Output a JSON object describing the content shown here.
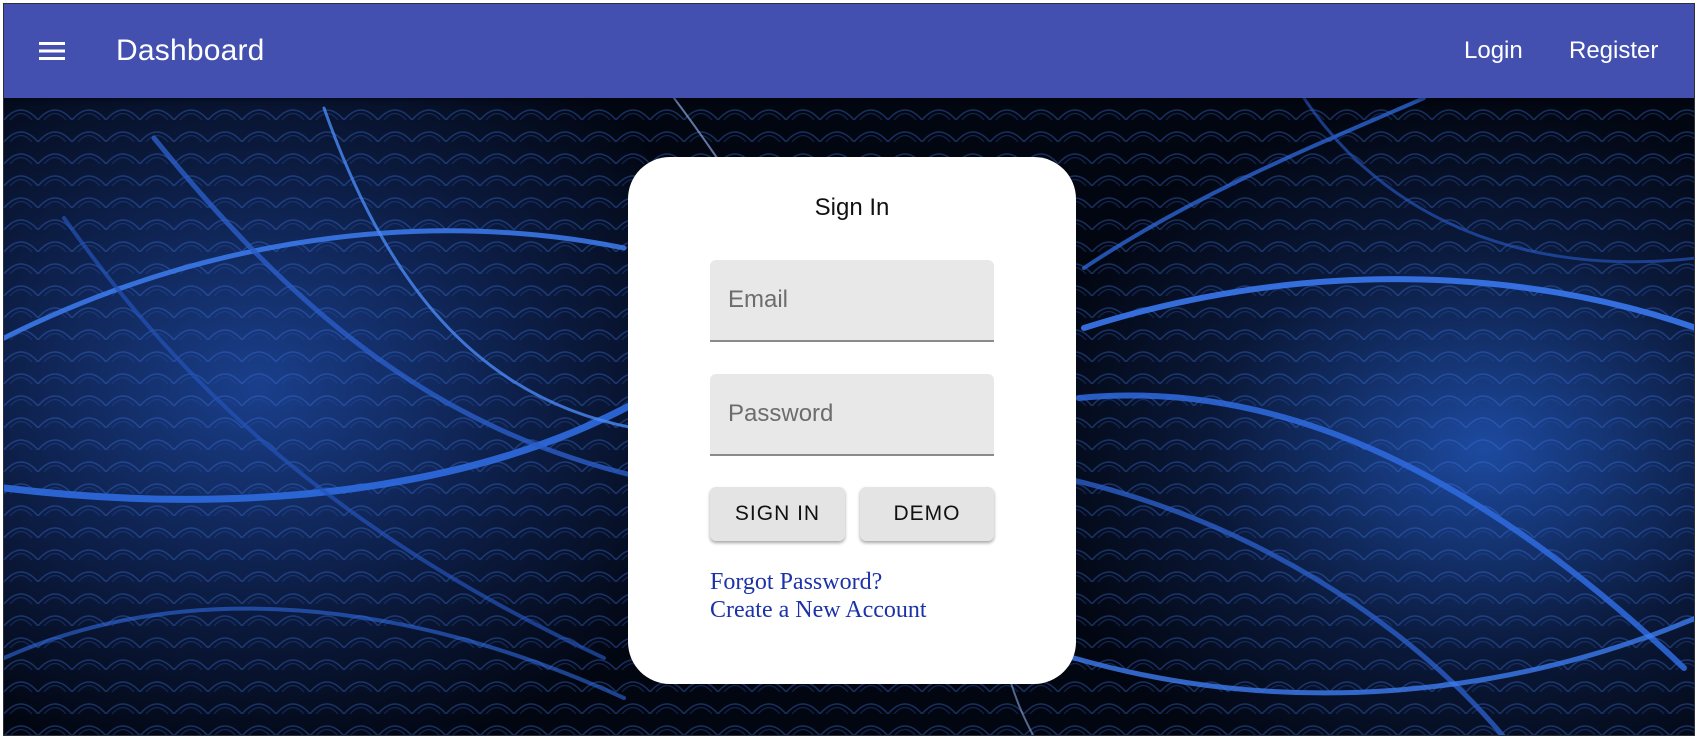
{
  "appbar": {
    "title": "Dashboard",
    "menu_icon": "hamburger-menu-icon",
    "nav": [
      {
        "label": "Login"
      },
      {
        "label": "Register"
      }
    ],
    "color": "#4350b0"
  },
  "signin": {
    "title": "Sign In",
    "email": {
      "placeholder": "Email",
      "value": ""
    },
    "password": {
      "placeholder": "Password",
      "value": ""
    },
    "buttons": {
      "signin_label": "SIGN IN",
      "demo_label": "DEMO"
    },
    "links": {
      "forgot": "Forgot Password?",
      "create": "Create a New Account"
    }
  },
  "background": {
    "description_color": "#1e5ad8"
  }
}
